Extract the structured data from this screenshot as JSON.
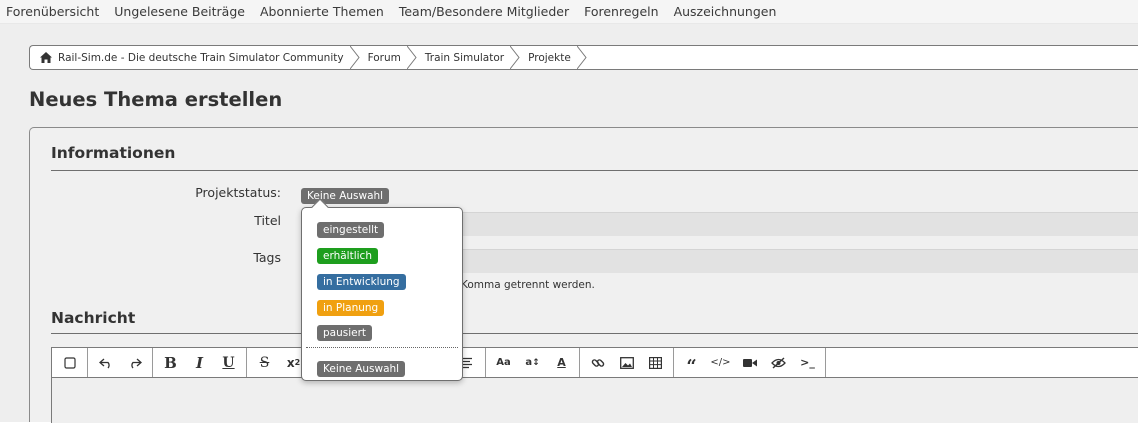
{
  "topnav": {
    "items": [
      "Forenübersicht",
      "Ungelesene Beiträge",
      "Abonnierte Themen",
      "Team/Besondere Mitglieder",
      "Forenregeln",
      "Auszeichnungen"
    ]
  },
  "breadcrumb": {
    "items": [
      "Rail-Sim.de - Die deutsche Train Simulator Community",
      "Forum",
      "Train Simulator",
      "Projekte"
    ]
  },
  "page": {
    "title": "Neues Thema erstellen"
  },
  "form": {
    "info_section": "Informationen",
    "status_label": "Projektstatus:",
    "status_value": "Keine Auswahl",
    "title_label": "Titel",
    "tags_label": "Tags",
    "tags_hint": "Komma getrennt werden.",
    "message_section": "Nachricht"
  },
  "dropdown": {
    "options": [
      {
        "label": "eingestellt",
        "color": "#6e6e6e"
      },
      {
        "label": "erhältlich",
        "color": "#1e9e1e"
      },
      {
        "label": "in Entwicklung",
        "color": "#356ea0"
      },
      {
        "label": "in Planung",
        "color": "#f0a010"
      },
      {
        "label": "pausiert",
        "color": "#6e6e6e"
      }
    ],
    "none_label": "Keine Auswahl",
    "none_color": "#6e6e6e"
  },
  "toolbar": {
    "groups": [
      [
        "checkbox-icon"
      ],
      [
        "undo-icon",
        "redo-icon"
      ],
      [
        "bold-icon",
        "italic-icon",
        "underline-icon"
      ],
      [
        "strikethrough-icon",
        "subscript-icon"
      ],
      [
        "align-icon"
      ],
      [
        "font-size-icon",
        "text-height-icon",
        "text-color-icon"
      ],
      [
        "link-icon",
        "image-icon",
        "table-icon"
      ],
      [
        "quote-icon",
        "code-icon",
        "video-icon",
        "spoiler-icon",
        "terminal-icon"
      ]
    ]
  },
  "colors": {
    "accent_text": "#333333",
    "panel_bg": "#f0f0f0"
  }
}
